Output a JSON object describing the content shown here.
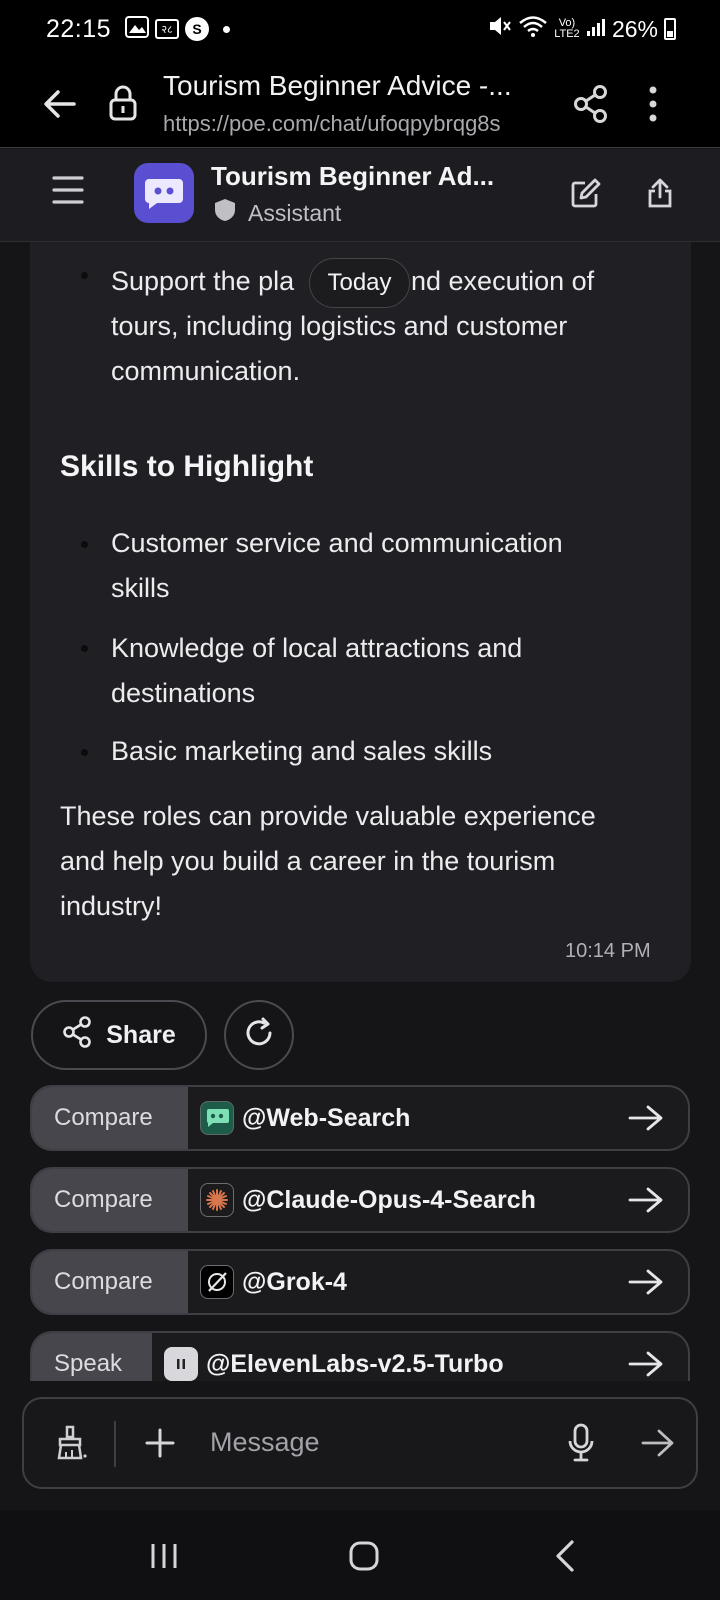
{
  "status_bar": {
    "time": "22:15",
    "box_icon_text": "२८",
    "circle_icon_text": "S",
    "network_label": "Vo) LTE2",
    "battery": "26%"
  },
  "browser": {
    "page_title": "Tourism Beginner Advice -...",
    "url": "https://poe.com/chat/ufoqpybrqg8s"
  },
  "chat_header": {
    "title": "Tourism Beginner Ad...",
    "subtitle": "Assistant"
  },
  "message": {
    "bullets_top": [
      "Support the pla",
      "nd execution of",
      "tours, including logistics and customer",
      "communication."
    ],
    "heading": "Skills to Highlight",
    "skills": [
      {
        "line1": "Customer service and communication",
        "line2": "skills"
      },
      {
        "line1": "Knowledge of local attractions and",
        "line2": "destinations"
      },
      {
        "line1": "Basic marketing and sales skills",
        "line2": ""
      }
    ],
    "closing": [
      "These roles can provide valuable experience",
      "and help you build a career in the tourism",
      "industry!"
    ],
    "timestamp": "10:14 PM",
    "date_pill": "Today"
  },
  "actions": {
    "share_label": "Share"
  },
  "suggestions": [
    {
      "action": "Compare",
      "bot": "@Web-Search",
      "icon": "robot-icon",
      "icon_color": "#1e5c4a"
    },
    {
      "action": "Compare",
      "bot": "@Claude-Opus-4-Search",
      "icon": "starburst-icon",
      "icon_color": "#d9774c"
    },
    {
      "action": "Compare",
      "bot": "@Grok-4",
      "icon": "grok-slash-icon",
      "icon_color": "#000000"
    },
    {
      "action": "Speak",
      "bot": "@ElevenLabs-v2.5-Turbo",
      "icon": "pause-icon",
      "icon_color": "#d8d8dc"
    }
  ],
  "input": {
    "placeholder": "Message"
  },
  "colors": {
    "accent_avatar": "#5b4fd1",
    "background": "#151517",
    "card": "#202024"
  }
}
